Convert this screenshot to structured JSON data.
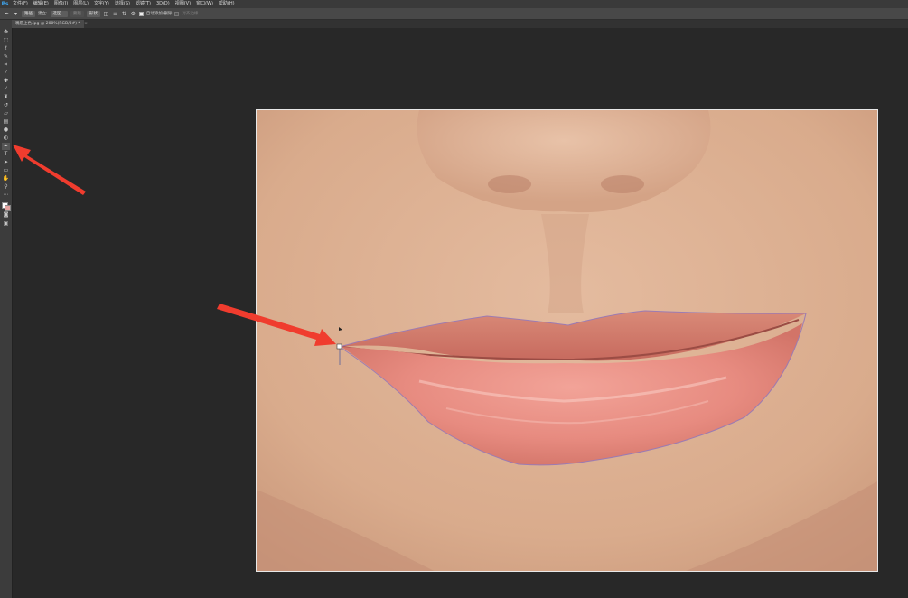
{
  "app": {
    "logo": "Ps"
  },
  "menu": [
    "文件(F)",
    "编辑(E)",
    "图像(I)",
    "图层(L)",
    "文字(Y)",
    "选择(S)",
    "滤镜(T)",
    "3D(D)",
    "视图(V)",
    "窗口(W)",
    "帮助(H)"
  ],
  "options": {
    "mode_select_label": "路径",
    "make_label": "建立:",
    "selection_button": "选区...",
    "mask_button": "蒙版",
    "shape_button": "形状",
    "auto_add_label": "自动添加/删除",
    "align_label": "对齐边缘"
  },
  "document": {
    "tab_title": "嘴唇上色.jpg @ 200%(RGB/8#) *",
    "close_glyph": "×"
  },
  "toolbar": {
    "tools": [
      {
        "name": "move-tool-icon",
        "glyph": "✥"
      },
      {
        "name": "marquee-tool-icon",
        "glyph": "⬚"
      },
      {
        "name": "lasso-tool-icon",
        "glyph": "ℓ"
      },
      {
        "name": "quick-select-tool-icon",
        "glyph": "✎"
      },
      {
        "name": "crop-tool-icon",
        "glyph": "⌗"
      },
      {
        "name": "eyedropper-tool-icon",
        "glyph": "⁄"
      },
      {
        "name": "healing-brush-tool-icon",
        "glyph": "✚"
      },
      {
        "name": "brush-tool-icon",
        "glyph": "⁄"
      },
      {
        "name": "clone-stamp-tool-icon",
        "glyph": "♜"
      },
      {
        "name": "history-brush-tool-icon",
        "glyph": "↺"
      },
      {
        "name": "eraser-tool-icon",
        "glyph": "▱"
      },
      {
        "name": "gradient-tool-icon",
        "glyph": "▤"
      },
      {
        "name": "blur-tool-icon",
        "glyph": "●"
      },
      {
        "name": "dodge-tool-icon",
        "glyph": "◐"
      },
      {
        "name": "pen-tool-icon",
        "glyph": "✒"
      },
      {
        "name": "type-tool-icon",
        "glyph": "T"
      },
      {
        "name": "path-selection-tool-icon",
        "glyph": "➤"
      },
      {
        "name": "rectangle-tool-icon",
        "glyph": "▭"
      },
      {
        "name": "hand-tool-icon",
        "glyph": "✋"
      },
      {
        "name": "zoom-tool-icon",
        "glyph": "⚲"
      },
      {
        "name": "edit-toolbar-icon",
        "glyph": "⋯"
      }
    ],
    "active_tool": "pen-tool-icon"
  },
  "colors": {
    "foreground": "#ffffff",
    "background_swatch": "#e4a3a0",
    "annotation_arrow": "#f03c2e",
    "skin": "#dfb396",
    "lip": "#e8897e",
    "path_outline": "#9b7bb3"
  }
}
